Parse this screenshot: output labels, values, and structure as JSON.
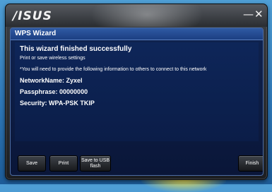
{
  "window": {
    "brand": "/ISUS",
    "minimize_glyph": "—",
    "close_glyph": "✕"
  },
  "dialog": {
    "title": "WPS Wizard",
    "success_text": "This wizard finished successfully",
    "subtitle": "Print or save wireless settings",
    "note": "*You will need to provide the following information to others to connect to this network",
    "network_name": "NetworkName: Zyxel",
    "passphrase": "Passphrase: 00000000",
    "security": "Security: WPA-PSK TKIP"
  },
  "buttons": {
    "save": "Save",
    "print": "Print",
    "save_usb": "Save to USB flash",
    "finish": "Finish"
  }
}
